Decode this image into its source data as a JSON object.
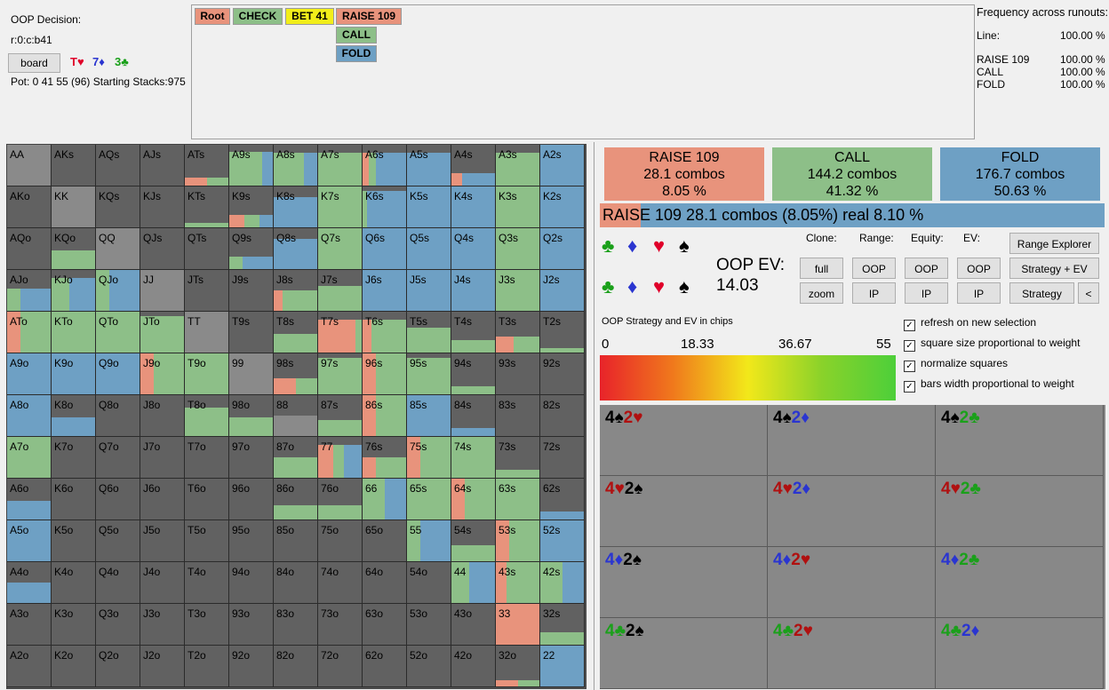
{
  "info": {
    "decision_label": "OOP Decision:",
    "line": "r:0:c:b41",
    "board_button": "board",
    "board_cards": [
      {
        "text": "T♥",
        "color": "#e0002a"
      },
      {
        "text": "7♦",
        "color": "#2a35d0"
      },
      {
        "text": "3♣",
        "color": "#1aa01a"
      }
    ],
    "pot_line": "Pot: 0 41 55 (96) Starting Stacks:975"
  },
  "tree": {
    "nodes": [
      {
        "label": "Root",
        "color": "#e8937c"
      },
      {
        "label": "CHECK",
        "color": "#8dbf88"
      },
      {
        "label": "BET 41",
        "color": "#f2ee1a"
      },
      {
        "label": "RAISE 109",
        "color": "#e8937c"
      },
      {
        "label": "CALL",
        "color": "#8dbf88"
      },
      {
        "label": "FOLD",
        "color": "#6ea0c4"
      }
    ]
  },
  "freq": {
    "title": "Frequency across runouts:",
    "line_label": "Line:",
    "line_value": "100.00 %",
    "rows": [
      {
        "name": "RAISE 109",
        "value": "100.00 %"
      },
      {
        "name": "CALL",
        "value": "100.00 %"
      },
      {
        "name": "FOLD",
        "value": "100.00 %"
      }
    ]
  },
  "colors": {
    "raise": "#e8937c",
    "call": "#8dbf88",
    "fold": "#6ea0c4",
    "empty": "#616161",
    "pair": "#8a8a8a"
  },
  "grid": {
    "rows": [
      [
        "AA",
        "AKs",
        "AQs",
        "AJs",
        "ATs",
        "A9s",
        "A8s",
        "A7s",
        "A6s",
        "A5s",
        "A4s",
        "A3s",
        "A2s"
      ],
      [
        "AKo",
        "KK",
        "KQs",
        "KJs",
        "KTs",
        "K9s",
        "K8s",
        "K7s",
        "K6s",
        "K5s",
        "K4s",
        "K3s",
        "K2s"
      ],
      [
        "AQo",
        "KQo",
        "QQ",
        "QJs",
        "QTs",
        "Q9s",
        "Q8s",
        "Q7s",
        "Q6s",
        "Q5s",
        "Q4s",
        "Q3s",
        "Q2s"
      ],
      [
        "AJo",
        "KJo",
        "QJo",
        "JJ",
        "JTs",
        "J9s",
        "J8s",
        "J7s",
        "J6s",
        "J5s",
        "J4s",
        "J3s",
        "J2s"
      ],
      [
        "ATo",
        "KTo",
        "QTo",
        "JTo",
        "TT",
        "T9s",
        "T8s",
        "T7s",
        "T6s",
        "T5s",
        "T4s",
        "T3s",
        "T2s"
      ],
      [
        "A9o",
        "K9o",
        "Q9o",
        "J9o",
        "T9o",
        "99",
        "98s",
        "97s",
        "96s",
        "95s",
        "94s",
        "93s",
        "92s"
      ],
      [
        "A8o",
        "K8o",
        "Q8o",
        "J8o",
        "T8o",
        "98o",
        "88",
        "87s",
        "86s",
        "85s",
        "84s",
        "83s",
        "82s"
      ],
      [
        "A7o",
        "K7o",
        "Q7o",
        "J7o",
        "T7o",
        "97o",
        "87o",
        "77",
        "76s",
        "75s",
        "74s",
        "73s",
        "72s"
      ],
      [
        "A6o",
        "K6o",
        "Q6o",
        "J6o",
        "T6o",
        "96o",
        "86o",
        "76o",
        "66",
        "65s",
        "64s",
        "63s",
        "62s"
      ],
      [
        "A5o",
        "K5o",
        "Q5o",
        "J5o",
        "T5o",
        "95o",
        "85o",
        "75o",
        "65o",
        "55",
        "54s",
        "53s",
        "52s"
      ],
      [
        "A4o",
        "K4o",
        "Q4o",
        "J4o",
        "T4o",
        "94o",
        "84o",
        "74o",
        "64o",
        "54o",
        "44",
        "43s",
        "42s"
      ],
      [
        "A3o",
        "K3o",
        "Q3o",
        "J3o",
        "T3o",
        "93o",
        "83o",
        "73o",
        "63o",
        "53o",
        "43o",
        "33",
        "32s"
      ],
      [
        "A2o",
        "K2o",
        "Q2o",
        "J2o",
        "T2o",
        "92o",
        "82o",
        "72o",
        "62o",
        "52o",
        "42o",
        "32o",
        "22"
      ]
    ],
    "strategy": {
      "A9s": {
        "w": 0.82,
        "r": 0,
        "c": 0.75,
        "f": 0.25
      },
      "A8s": {
        "w": 0.8,
        "r": 0,
        "c": 0.7,
        "f": 0.3
      },
      "A7s": {
        "w": 0.8,
        "r": 0,
        "c": 1,
        "f": 0
      },
      "A6s": {
        "w": 0.8,
        "r": 0.15,
        "c": 0.15,
        "f": 0.7
      },
      "A5s": {
        "w": 0.8,
        "r": 0,
        "c": 0,
        "f": 1
      },
      "A4s": {
        "w": 0.3,
        "r": 0.25,
        "c": 0,
        "f": 0.75
      },
      "A3s": {
        "w": 0.8,
        "r": 0,
        "c": 1,
        "f": 0
      },
      "A2s": {
        "w": 1,
        "r": 0,
        "c": 0,
        "f": 1
      },
      "ATs": {
        "w": 0.2,
        "r": 0.5,
        "c": 0.5,
        "f": 0
      },
      "K9s": {
        "w": 0.3,
        "r": 0.35,
        "c": 0.35,
        "f": 0.3
      },
      "K8s": {
        "w": 0.75,
        "r": 0,
        "c": 0,
        "f": 1
      },
      "K7s": {
        "w": 1,
        "r": 0,
        "c": 1,
        "f": 0
      },
      "K6s": {
        "w": 0.9,
        "r": 0,
        "c": 0.1,
        "f": 0.9
      },
      "K5s": {
        "w": 1,
        "r": 0,
        "c": 0,
        "f": 1
      },
      "K4s": {
        "w": 1,
        "r": 0,
        "c": 0,
        "f": 1
      },
      "K3s": {
        "w": 1,
        "r": 0,
        "c": 1,
        "f": 0
      },
      "K2s": {
        "w": 1,
        "r": 0,
        "c": 0,
        "f": 1
      },
      "KTs": {
        "w": 0.1,
        "r": 0,
        "c": 1,
        "f": 0
      },
      "Q9s": {
        "w": 0.3,
        "r": 0,
        "c": 0.3,
        "f": 0.7
      },
      "Q8s": {
        "w": 0.75,
        "r": 0,
        "c": 0,
        "f": 1
      },
      "Q7s": {
        "w": 1,
        "r": 0,
        "c": 1,
        "f": 0
      },
      "Q6s": {
        "w": 1,
        "r": 0,
        "c": 0,
        "f": 1
      },
      "Q5s": {
        "w": 1,
        "r": 0,
        "c": 0,
        "f": 1
      },
      "Q4s": {
        "w": 1,
        "r": 0,
        "c": 0,
        "f": 1
      },
      "Q3s": {
        "w": 1,
        "r": 0,
        "c": 1,
        "f": 0
      },
      "Q2s": {
        "w": 1,
        "r": 0,
        "c": 0,
        "f": 1
      },
      "KQo": {
        "w": 0.45,
        "r": 0,
        "c": 1,
        "f": 0
      },
      "AJo": {
        "w": 0.55,
        "r": 0,
        "c": 0.3,
        "f": 0.7
      },
      "KJo": {
        "w": 0.8,
        "r": 0,
        "c": 0.4,
        "f": 0.6
      },
      "QJo": {
        "w": 1,
        "r": 0,
        "c": 0.3,
        "f": 0.7
      },
      "J8s": {
        "w": 0.5,
        "r": 0.2,
        "c": 0.8,
        "f": 0
      },
      "J7s": {
        "w": 0.6,
        "r": 0,
        "c": 1,
        "f": 0
      },
      "J6s": {
        "w": 1,
        "r": 0,
        "c": 0,
        "f": 1
      },
      "J5s": {
        "w": 1,
        "r": 0,
        "c": 0,
        "f": 1
      },
      "J4s": {
        "w": 1,
        "r": 0,
        "c": 0,
        "f": 1
      },
      "J3s": {
        "w": 1,
        "r": 0,
        "c": 1,
        "f": 0
      },
      "J2s": {
        "w": 1,
        "r": 0,
        "c": 0,
        "f": 1
      },
      "ATo": {
        "w": 1,
        "r": 0.3,
        "c": 0.7,
        "f": 0
      },
      "KTo": {
        "w": 1,
        "r": 0,
        "c": 1,
        "f": 0
      },
      "QTo": {
        "w": 1,
        "r": 0,
        "c": 1,
        "f": 0
      },
      "JTo": {
        "w": 0.9,
        "r": 0,
        "c": 1,
        "f": 0
      },
      "T8s": {
        "w": 0.45,
        "r": 0,
        "c": 1,
        "f": 0
      },
      "T7s": {
        "w": 0.8,
        "r": 0.85,
        "c": 0.15,
        "f": 0
      },
      "T6s": {
        "w": 0.8,
        "r": 0.2,
        "c": 0.8,
        "f": 0
      },
      "T5s": {
        "w": 0.6,
        "r": 0,
        "c": 1,
        "f": 0
      },
      "T4s": {
        "w": 0.3,
        "r": 0,
        "c": 1,
        "f": 0
      },
      "T3s": {
        "w": 0.4,
        "r": 0.4,
        "c": 0.6,
        "f": 0
      },
      "T2s": {
        "w": 0.1,
        "r": 0,
        "c": 1,
        "f": 0
      },
      "A9o": {
        "w": 1,
        "r": 0,
        "c": 0,
        "f": 1
      },
      "K9o": {
        "w": 1,
        "r": 0,
        "c": 0,
        "f": 1
      },
      "Q9o": {
        "w": 1,
        "r": 0,
        "c": 0,
        "f": 1
      },
      "J9o": {
        "w": 1,
        "r": 0.3,
        "c": 0.7,
        "f": 0
      },
      "T9o": {
        "w": 1,
        "r": 0,
        "c": 1,
        "f": 0
      },
      "98s": {
        "w": 0.4,
        "r": 0.5,
        "c": 0.5,
        "f": 0
      },
      "97s": {
        "w": 0.9,
        "r": 0,
        "c": 1,
        "f": 0
      },
      "96s": {
        "w": 1,
        "r": 0.3,
        "c": 0.7,
        "f": 0
      },
      "95s": {
        "w": 0.9,
        "r": 0,
        "c": 1,
        "f": 0
      },
      "94s": {
        "w": 0.2,
        "r": 0,
        "c": 1,
        "f": 0
      },
      "A8o": {
        "w": 1,
        "r": 0,
        "c": 0,
        "f": 1
      },
      "K8o": {
        "w": 0.45,
        "r": 0,
        "c": 0,
        "f": 1
      },
      "T8o": {
        "w": 0.7,
        "r": 0,
        "c": 1,
        "f": 0
      },
      "98o": {
        "w": 0.45,
        "r": 0,
        "c": 1,
        "f": 0
      },
      "87s": {
        "w": 0.4,
        "r": 0,
        "c": 1,
        "f": 0
      },
      "86s": {
        "w": 1,
        "r": 0.3,
        "c": 0.7,
        "f": 0
      },
      "85s": {
        "w": 1,
        "r": 0,
        "c": 0,
        "f": 1
      },
      "84s": {
        "w": 0.2,
        "r": 0,
        "c": 0,
        "f": 1
      },
      "A7o": {
        "w": 1,
        "r": 0,
        "c": 1,
        "f": 0
      },
      "87o": {
        "w": 0.5,
        "r": 0,
        "c": 1,
        "f": 0
      },
      "76s": {
        "w": 0.5,
        "r": 0.3,
        "c": 0.7,
        "f": 0
      },
      "75s": {
        "w": 1,
        "r": 0.3,
        "c": 0.7,
        "f": 0
      },
      "74s": {
        "w": 1,
        "r": 0,
        "c": 1,
        "f": 0
      },
      "73s": {
        "w": 0.2,
        "r": 0,
        "c": 1,
        "f": 0
      },
      "A6o": {
        "w": 0.45,
        "r": 0,
        "c": 0,
        "f": 1
      },
      "86o": {
        "w": 0.35,
        "r": 0,
        "c": 1,
        "f": 0
      },
      "76o": {
        "w": 0.35,
        "r": 0,
        "c": 1,
        "f": 0
      },
      "65s": {
        "w": 1,
        "r": 0,
        "c": 1,
        "f": 0
      },
      "64s": {
        "w": 1,
        "r": 0.3,
        "c": 0.7,
        "f": 0
      },
      "63s": {
        "w": 1,
        "r": 0,
        "c": 1,
        "f": 0
      },
      "62s": {
        "w": 0.2,
        "r": 0,
        "c": 0,
        "f": 1
      },
      "A5o": {
        "w": 1,
        "r": 0,
        "c": 0,
        "f": 1
      },
      "55": {
        "w": 1,
        "r": 0,
        "c": 0.3,
        "f": 0.7
      },
      "54s": {
        "w": 0.4,
        "r": 0,
        "c": 1,
        "f": 0
      },
      "53s": {
        "w": 1,
        "r": 0.3,
        "c": 0.7,
        "f": 0
      },
      "52s": {
        "w": 1,
        "r": 0,
        "c": 0,
        "f": 1
      },
      "A4o": {
        "w": 0.5,
        "r": 0,
        "c": 0,
        "f": 1
      },
      "44": {
        "w": 1,
        "r": 0,
        "c": 0.4,
        "f": 0.6
      },
      "43s": {
        "w": 1,
        "r": 0.25,
        "c": 0.75,
        "f": 0
      },
      "42s": {
        "w": 1,
        "r": 0,
        "c": 0.5,
        "f": 0.5
      },
      "33": {
        "w": 1,
        "r": 1,
        "c": 0,
        "f": 0
      },
      "32s": {
        "w": 0.3,
        "r": 0,
        "c": 1,
        "f": 0
      },
      "32o": {
        "w": 0.15,
        "r": 0.5,
        "c": 0.5,
        "f": 0
      },
      "22": {
        "w": 1,
        "r": 0,
        "c": 0,
        "f": 1
      },
      "66": {
        "w": 1,
        "r": 0,
        "c": 0.5,
        "f": 0.5
      },
      "77": {
        "w": 0.8,
        "r": 0.35,
        "c": 0.25,
        "f": 0.4
      },
      "88": {
        "w": 0.5,
        "r": 0,
        "c": 0,
        "f": 0
      },
      "99": {
        "w": 1,
        "r": 0,
        "c": 0,
        "f": 0
      },
      "TT": {
        "w": 1,
        "r": 0,
        "c": 0,
        "f": 0
      },
      "JJ": {
        "w": 1,
        "r": 0,
        "c": 0,
        "f": 0
      },
      "QQ": {
        "w": 1,
        "r": 0,
        "c": 0,
        "f": 0
      },
      "KK": {
        "w": 1,
        "r": 0,
        "c": 0,
        "f": 0
      },
      "AA": {
        "w": 1,
        "r": 0,
        "c": 0,
        "f": 0
      }
    }
  },
  "actions": [
    {
      "name": "RAISE 109",
      "combos": "28.1 combos",
      "pct": "8.05 %",
      "color": "#e8937c"
    },
    {
      "name": "CALL",
      "combos": "144.2 combos",
      "pct": "41.32 %",
      "color": "#8dbf88"
    },
    {
      "name": "FOLD",
      "combos": "176.7 combos",
      "pct": "50.63 %",
      "color": "#6ea0c4"
    }
  ],
  "selected_bar": {
    "text": "RAISE 109   28.1 combos (8.05%) real  8.10 %",
    "fraction": 0.081
  },
  "suits": [
    {
      "glyph": "♣",
      "color": "#1aa01a"
    },
    {
      "glyph": "♦",
      "color": "#2a35d0"
    },
    {
      "glyph": "♥",
      "color": "#e0002a"
    },
    {
      "glyph": "♠",
      "color": "#000000"
    }
  ],
  "ev": {
    "label": "OOP EV:",
    "value": "14.03"
  },
  "controls": {
    "clone_label": "Clone:",
    "range_label": "Range:",
    "equity_label": "Equity:",
    "ev_label": "EV:",
    "full": "full",
    "zoom": "zoom",
    "oop": "OOP",
    "ip": "IP",
    "range_explorer": "Range Explorer",
    "strategy_ev": "Strategy + EV",
    "strategy": "Strategy",
    "back": "<"
  },
  "legend": {
    "title": "OOP Strategy and EV in chips",
    "ticks": [
      "0",
      "18.33",
      "36.67",
      "55"
    ]
  },
  "checks": [
    "refresh on new selection",
    "square size proportional to weight",
    "normalize squares",
    "bars width proportional to weight"
  ],
  "combos": [
    [
      {
        "c1": "4",
        "s1": "♠",
        "k1": "#000",
        "c2": "2",
        "s2": "♥",
        "k2": "#b01010"
      },
      {
        "c1": "4",
        "s1": "♠",
        "k1": "#000",
        "c2": "2",
        "s2": "♦",
        "k2": "#2a35d0"
      },
      {
        "c1": "4",
        "s1": "♠",
        "k1": "#000",
        "c2": "2",
        "s2": "♣",
        "k2": "#1aa01a"
      }
    ],
    [
      {
        "c1": "4",
        "s1": "♥",
        "k1": "#b01010",
        "c2": "2",
        "s2": "♠",
        "k2": "#000"
      },
      {
        "c1": "4",
        "s1": "♥",
        "k1": "#b01010",
        "c2": "2",
        "s2": "♦",
        "k2": "#2a35d0"
      },
      {
        "c1": "4",
        "s1": "♥",
        "k1": "#b01010",
        "c2": "2",
        "s2": "♣",
        "k2": "#1aa01a"
      }
    ],
    [
      {
        "c1": "4",
        "s1": "♦",
        "k1": "#2a35d0",
        "c2": "2",
        "s2": "♠",
        "k2": "#000"
      },
      {
        "c1": "4",
        "s1": "♦",
        "k1": "#2a35d0",
        "c2": "2",
        "s2": "♥",
        "k2": "#b01010"
      },
      {
        "c1": "4",
        "s1": "♦",
        "k1": "#2a35d0",
        "c2": "2",
        "s2": "♣",
        "k2": "#1aa01a"
      }
    ],
    [
      {
        "c1": "4",
        "s1": "♣",
        "k1": "#1aa01a",
        "c2": "2",
        "s2": "♠",
        "k2": "#000"
      },
      {
        "c1": "4",
        "s1": "♣",
        "k1": "#1aa01a",
        "c2": "2",
        "s2": "♥",
        "k2": "#b01010"
      },
      {
        "c1": "4",
        "s1": "♣",
        "k1": "#1aa01a",
        "c2": "2",
        "s2": "♦",
        "k2": "#2a35d0"
      }
    ]
  ]
}
